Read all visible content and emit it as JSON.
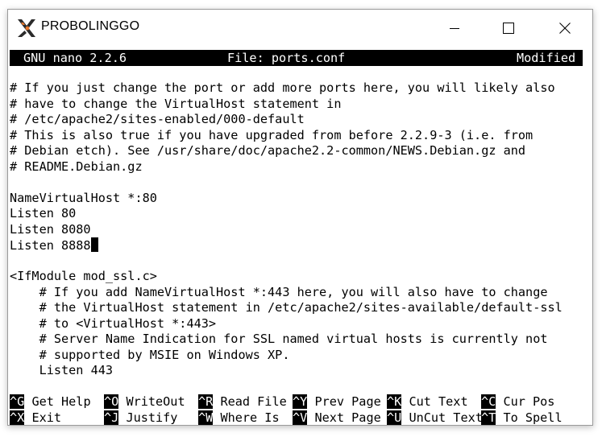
{
  "window": {
    "title": "PROBOLINGGO",
    "controls": {
      "minimize": "minimize-icon",
      "maximize": "maximize-icon",
      "close": "close-icon"
    }
  },
  "nano": {
    "header": {
      "version": "GNU nano 2.2.6",
      "file": "File: ports.conf",
      "status": "Modified"
    },
    "lines": [
      "",
      "# If you just change the port or add more ports here, you will likely also",
      "# have to change the VirtualHost statement in",
      "# /etc/apache2/sites-enabled/000-default",
      "# This is also true if you have upgraded from before 2.2.9-3 (i.e. from",
      "# Debian etch). See /usr/share/doc/apache2.2-common/NEWS.Debian.gz and",
      "# README.Debian.gz",
      "",
      "NameVirtualHost *:80",
      "Listen 80",
      "Listen 8080",
      "Listen 8888",
      "",
      "<IfModule mod_ssl.c>",
      "    # If you add NameVirtualHost *:443 here, you will also have to change",
      "    # the VirtualHost statement in /etc/apache2/sites-available/default-ssl",
      "    # to <VirtualHost *:443>",
      "    # Server Name Indication for SSL named virtual hosts is currently not",
      "    # supported by MSIE on Windows XP.",
      "    Listen 443"
    ],
    "shortcuts_row1": [
      {
        "key": "^G",
        "label": " Get Help"
      },
      {
        "key": "^O",
        "label": " WriteOut"
      },
      {
        "key": "^R",
        "label": " Read File"
      },
      {
        "key": "^Y",
        "label": " Prev Page"
      },
      {
        "key": "^K",
        "label": " Cut Text"
      },
      {
        "key": "^C",
        "label": " Cur Pos"
      }
    ],
    "shortcuts_row2": [
      {
        "key": "^X",
        "label": " Exit"
      },
      {
        "key": "^J",
        "label": " Justify"
      },
      {
        "key": "^W",
        "label": " Where Is"
      },
      {
        "key": "^V",
        "label": " Next Page"
      },
      {
        "key": "^U",
        "label": " UnCut Text"
      },
      {
        "key": "^T",
        "label": " To Spell"
      }
    ]
  },
  "colors": {
    "background": "#ffffff",
    "foreground": "#000000",
    "logo_dark": "#2b2b2b",
    "logo_orange": "#e8762b"
  }
}
